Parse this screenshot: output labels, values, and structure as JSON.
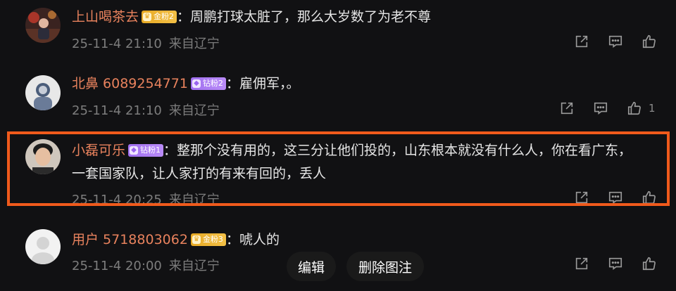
{
  "comments": [
    {
      "username": "上山喝茶去",
      "badge_label": "金粉2",
      "badge_type": "gold",
      "text": "：周鹏打球太脏了，那么大岁数了为老不尊",
      "date": "25-11-4 21:10",
      "location": "来自辽宁",
      "likes": ""
    },
    {
      "username": "北鼻 6089254771",
      "badge_label": "钻粉2",
      "badge_type": "diamond",
      "text": "：雇佣军，。",
      "date": "25-11-4 21:10",
      "location": "来自辽宁",
      "likes": "1"
    },
    {
      "username": "小磊可乐",
      "badge_label": "钻粉1",
      "badge_type": "diamond",
      "text": "：整那个没有用的，这三分让他们投的，山东根本就没有什么人，你在看广东，",
      "text_line2": "一套国家队，让人家打的有来有回的，丢人",
      "date": "25-11-4 20:25",
      "location": "来自辽宁",
      "likes": ""
    },
    {
      "username": "用户 5718803062",
      "badge_label": "金粉3",
      "badge_type": "gold",
      "text": "：唬人的",
      "date": "25-11-4 20:00",
      "location": "来自辽宁",
      "likes": ""
    }
  ],
  "overlay": {
    "edit_label": "编辑",
    "delete_annotation_label": "删除图注"
  },
  "colors": {
    "background": "#111113",
    "username": "#e8825d",
    "meta": "#7d7d7d",
    "highlight_border": "#f05a1c",
    "gold_badge": "#e7a924",
    "diamond_badge": "#a06ff0"
  }
}
